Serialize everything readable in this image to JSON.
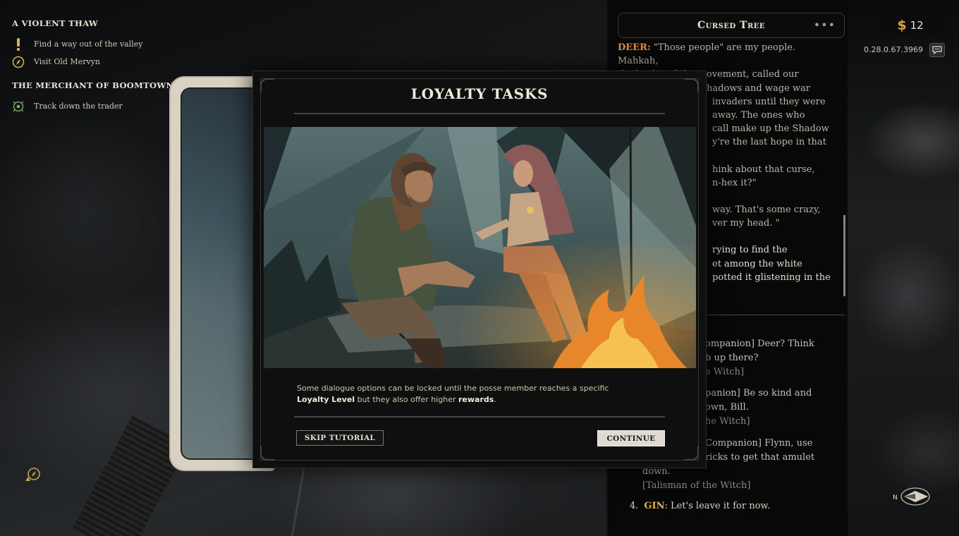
{
  "quests": [
    {
      "title": "A VIOLENT THAW",
      "tasks": [
        {
          "text": "Find a way out of the valley",
          "icon": "exclamation-icon"
        },
        {
          "text": "Visit Old Mervyn",
          "icon": "compass-quest-icon"
        }
      ]
    },
    {
      "title": "THE MERCHANT OF BOOMTOWN",
      "tasks": [
        {
          "text": "Track down the trader",
          "icon": "target-quest-icon"
        }
      ]
    }
  ],
  "dialogue": {
    "title": "Cursed Tree",
    "menu_label": "•••",
    "speaker": "DEER:",
    "lines": [
      " \"Those people\" are my people. Mahkah,",
      "the leader of the movement, called our",
      "the shadows and wage war",
      "invaders until they were",
      "away. The ones who",
      "call make up the Shadow",
      "y're the last hope in that",
      "hink about that curse,",
      "n-hex it?\"",
      "way. That's some crazy,",
      "ver my head. \"",
      "rying to find the",
      "et among the white",
      "potted it glistening in the"
    ],
    "options": [
      {
        "lines": [
          "ompanion] Deer? Think",
          "b up there?"
        ],
        "tag": "e Witch]"
      },
      {
        "lines": [
          "panion] Be so kind and",
          "own, Bill."
        ],
        "tag": "he Witch]"
      },
      {
        "lines": [
          "Companion] Flynn, use",
          "ricks to get that amulet",
          "down."
        ],
        "tag": "[Talisman of the Witch]"
      }
    ],
    "final_option": {
      "number": "4.",
      "speaker": "GIN",
      "text": ": Let's leave it for now."
    }
  },
  "hud": {
    "money_symbol": "$",
    "money": "12",
    "version": "0.28.0.67.3969",
    "chat_icon": "chat-bubble-icon",
    "compass_label": "N"
  },
  "modal": {
    "title": "LOYALTY TASKS",
    "description_parts": {
      "p1": "Some dialogue options can be locked until the posse member reaches a specific",
      "b1": "Loyalty Level",
      "p2": " but they also offer higher ",
      "b2": "rewards",
      "p3": "."
    },
    "skip_label": "SKIP TUTORIAL",
    "continue_label": "CONTINUE"
  },
  "colors": {
    "speaker": "#e38b44",
    "gin": "#e1b24c",
    "money_symbol": "#d9a441",
    "continue_bg": "#dedad2"
  }
}
